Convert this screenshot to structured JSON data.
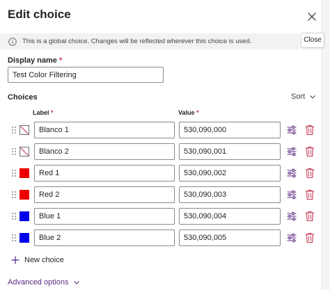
{
  "dialog": {
    "title": "Edit choice",
    "close_tooltip": "Close"
  },
  "notice": {
    "text": "This is a global choice. Changes will be reflected wherever this choice is used."
  },
  "display_name": {
    "label": "Display name",
    "required_mark": "*",
    "value": "Test Color Filtering"
  },
  "choices": {
    "title": "Choices",
    "sort_label": "Sort",
    "label_header": "Label",
    "value_header": "Value",
    "required_mark": "*",
    "rows": [
      {
        "label": "Blanco 1",
        "value": "530,090,000",
        "color": ""
      },
      {
        "label": "Blanco 2",
        "value": "530,090,001",
        "color": ""
      },
      {
        "label": "Red 1",
        "value": "530,090,002",
        "color": "#ee0000"
      },
      {
        "label": "Red 2",
        "value": "530,090,003",
        "color": "#ee0000"
      },
      {
        "label": "Blue 1",
        "value": "530,090,004",
        "color": "#0000ee"
      },
      {
        "label": "Blue 2",
        "value": "530,090,005",
        "color": "#0000ee"
      }
    ]
  },
  "new_choice_label": "New choice",
  "advanced_options_label": "Advanced options",
  "colors": {
    "accent": "#5b2a86",
    "notice_bg": "#f3f2f1",
    "required": "#c4314b"
  }
}
